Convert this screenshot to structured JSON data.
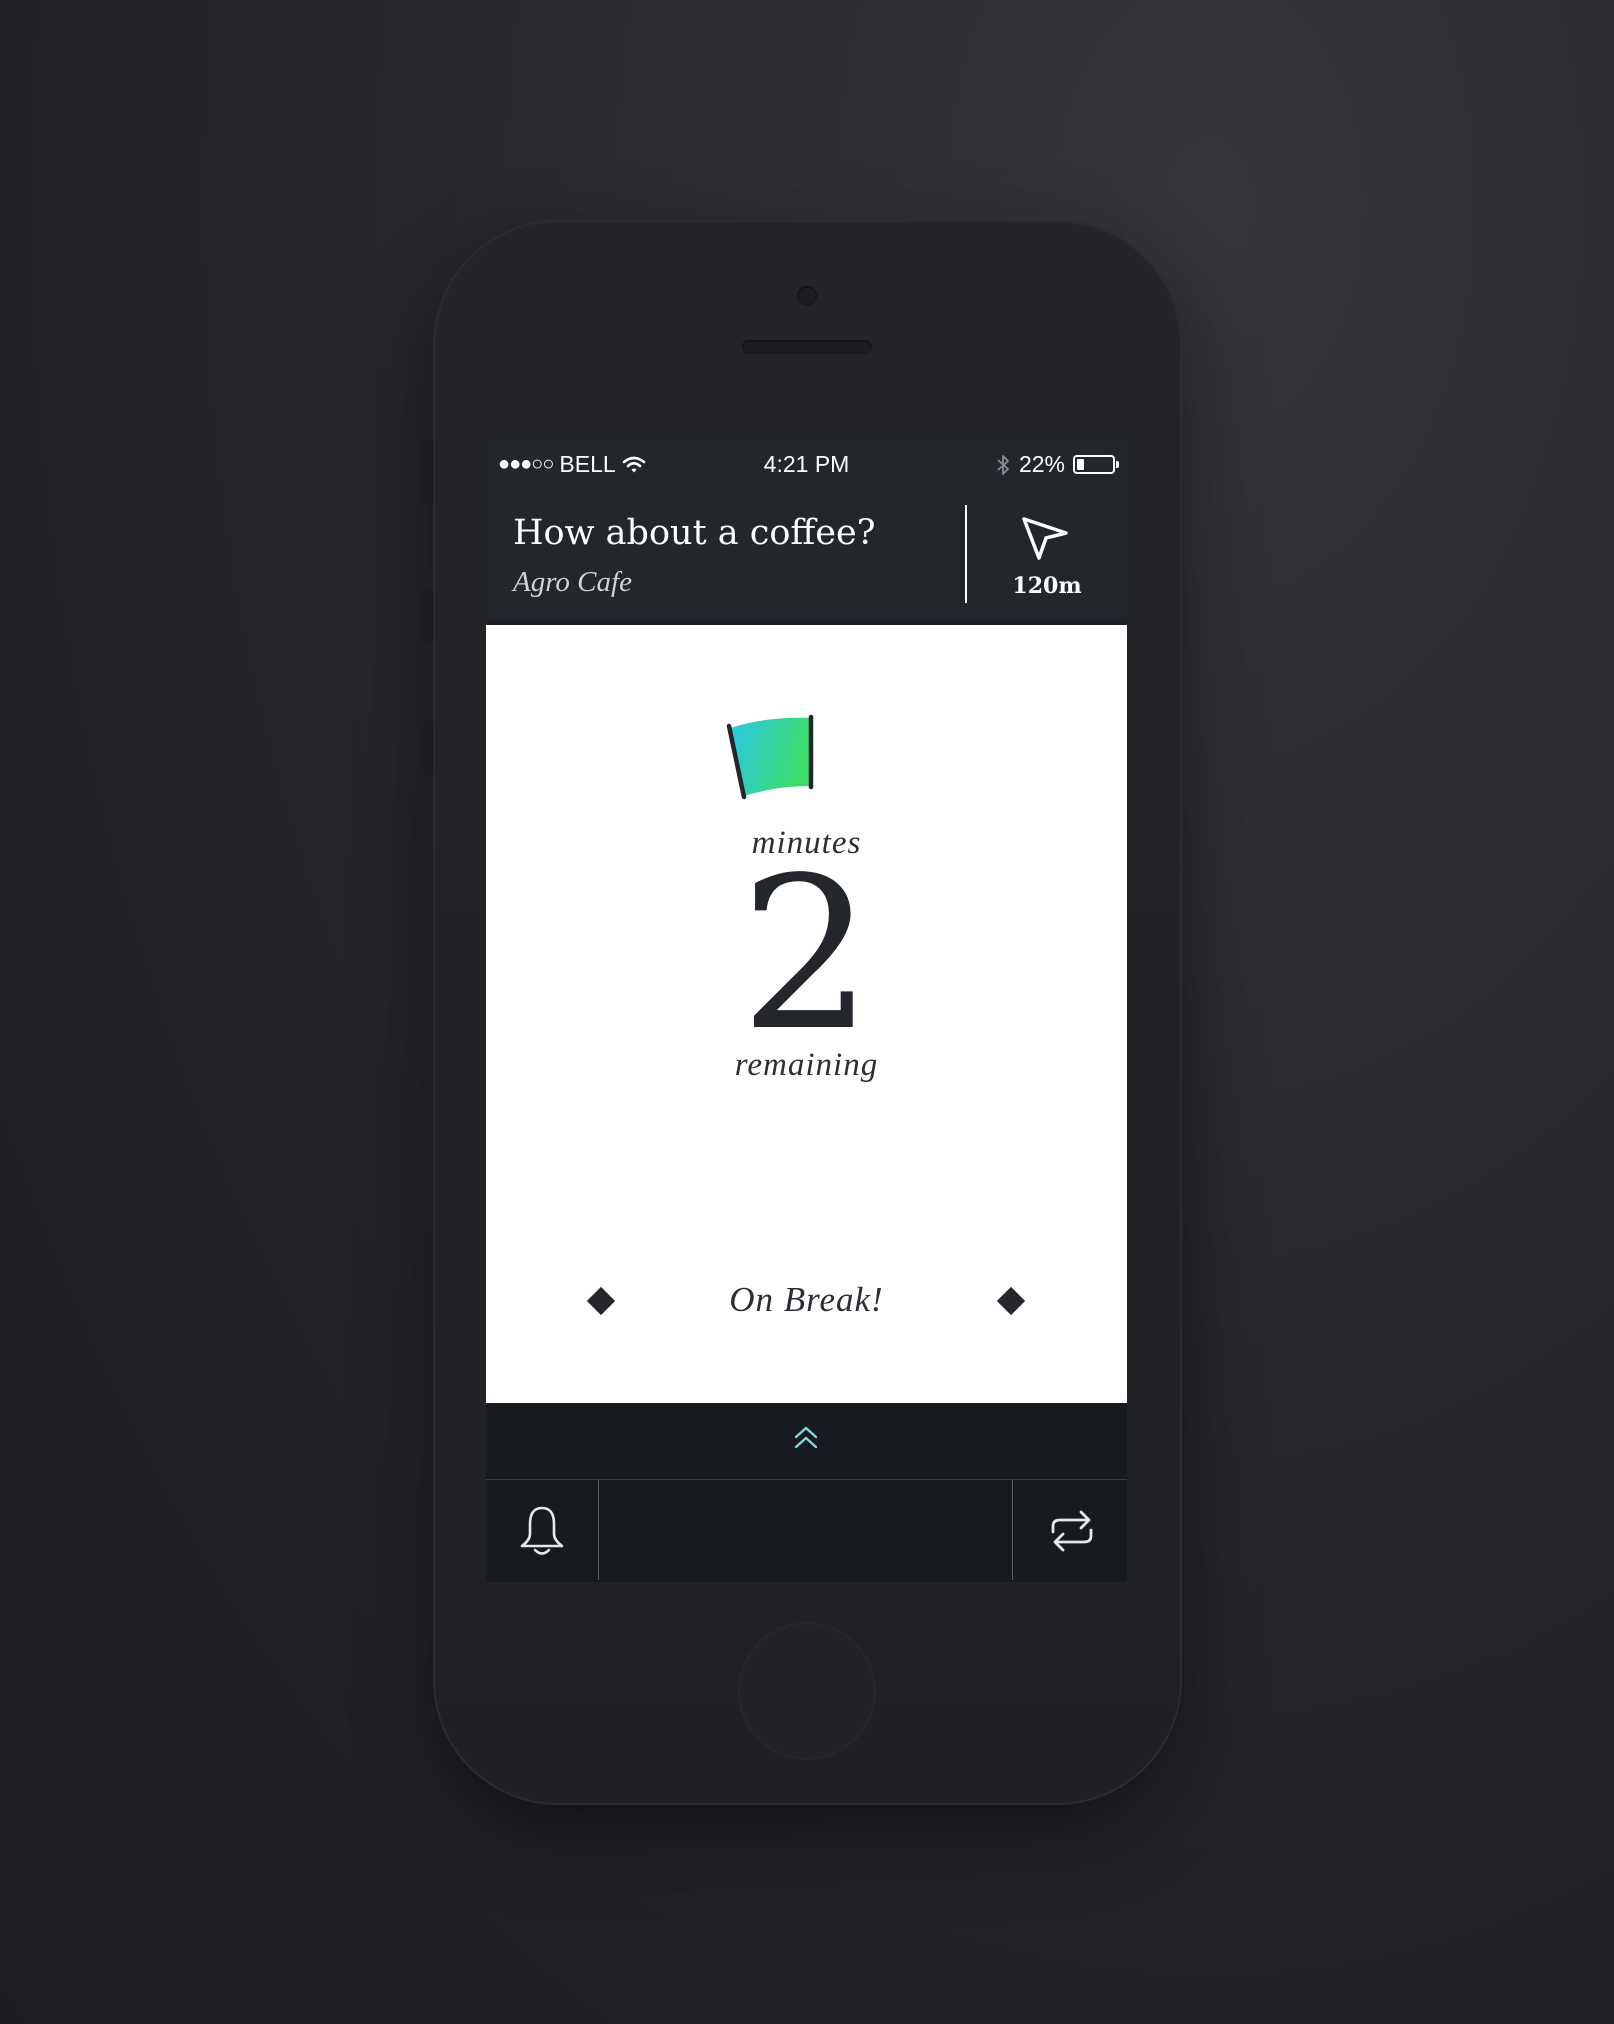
{
  "status_bar": {
    "signal": "●●●○○",
    "carrier": "BELL",
    "time": "4:21 PM",
    "battery_percent": "22%",
    "battery_level": 0.22,
    "icons": [
      "wifi-icon",
      "bluetooth-icon",
      "battery-icon"
    ]
  },
  "header": {
    "title": "How about a coffee?",
    "subtitle": "Agro Cafe",
    "nav_icon": "location-arrow-icon",
    "distance": "120m"
  },
  "timer": {
    "top_label": "minutes",
    "value": "2",
    "bottom_label": "remaining",
    "icon": "coffee-cup-icon",
    "cup_fill_colors": [
      "#2ac8e8",
      "#3ddc6a"
    ]
  },
  "footer_card": {
    "status": "On Break!"
  },
  "bottom": {
    "expand_icon": "chevron-double-up-icon",
    "left_icon": "bell-icon",
    "right_icon": "repeat-icon"
  },
  "colors": {
    "dark_bg": "#23272c",
    "toolbar_bg": "#171b1f",
    "accent_teal": "#7fd6e0",
    "card_bg": "#ffffff"
  }
}
